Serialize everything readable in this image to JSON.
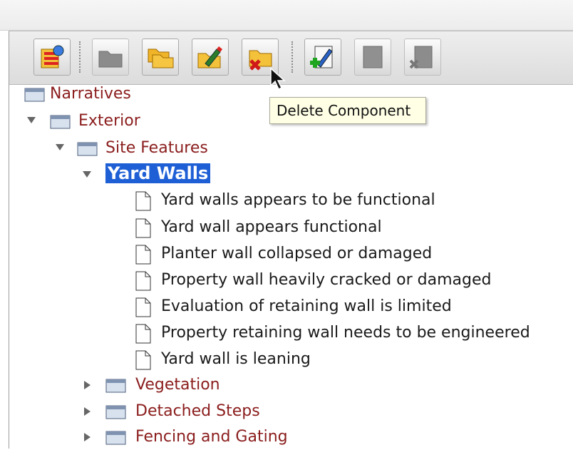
{
  "toolbar": {
    "buttons": [
      {
        "icon": "new-library-icon",
        "enabled": true
      },
      {
        "icon": "folder-gray-icon",
        "enabled": false
      },
      {
        "icon": "new-folder-icon",
        "enabled": true
      },
      {
        "icon": "edit-folder-icon",
        "enabled": true
      },
      {
        "icon": "delete-folder-icon",
        "enabled": true
      },
      {
        "icon": "add-item-icon",
        "enabled": true
      },
      {
        "icon": "edit-item-icon",
        "enabled": false
      },
      {
        "icon": "delete-item-icon",
        "enabled": false
      }
    ]
  },
  "tooltip": {
    "text": "Delete Component"
  },
  "tree": {
    "root": "Narratives",
    "exterior": "Exterior",
    "site_features": "Site Features",
    "selected": "Yard Walls",
    "items": [
      "Yard walls appears to be functional",
      "Yard wall appears functional",
      "Planter wall collapsed or damaged",
      "Property wall heavily cracked or damaged",
      "Evaluation of retaining wall is limited",
      "Property retaining wall needs to be engineered",
      "Yard wall is leaning"
    ],
    "siblings": [
      "Vegetation",
      "Detached Steps",
      "Fencing and Gating"
    ]
  },
  "colors": {
    "folder_label": "#8b1d1d",
    "selection": "#1e5fd6",
    "tooltip_bg": "#ffffe6"
  }
}
